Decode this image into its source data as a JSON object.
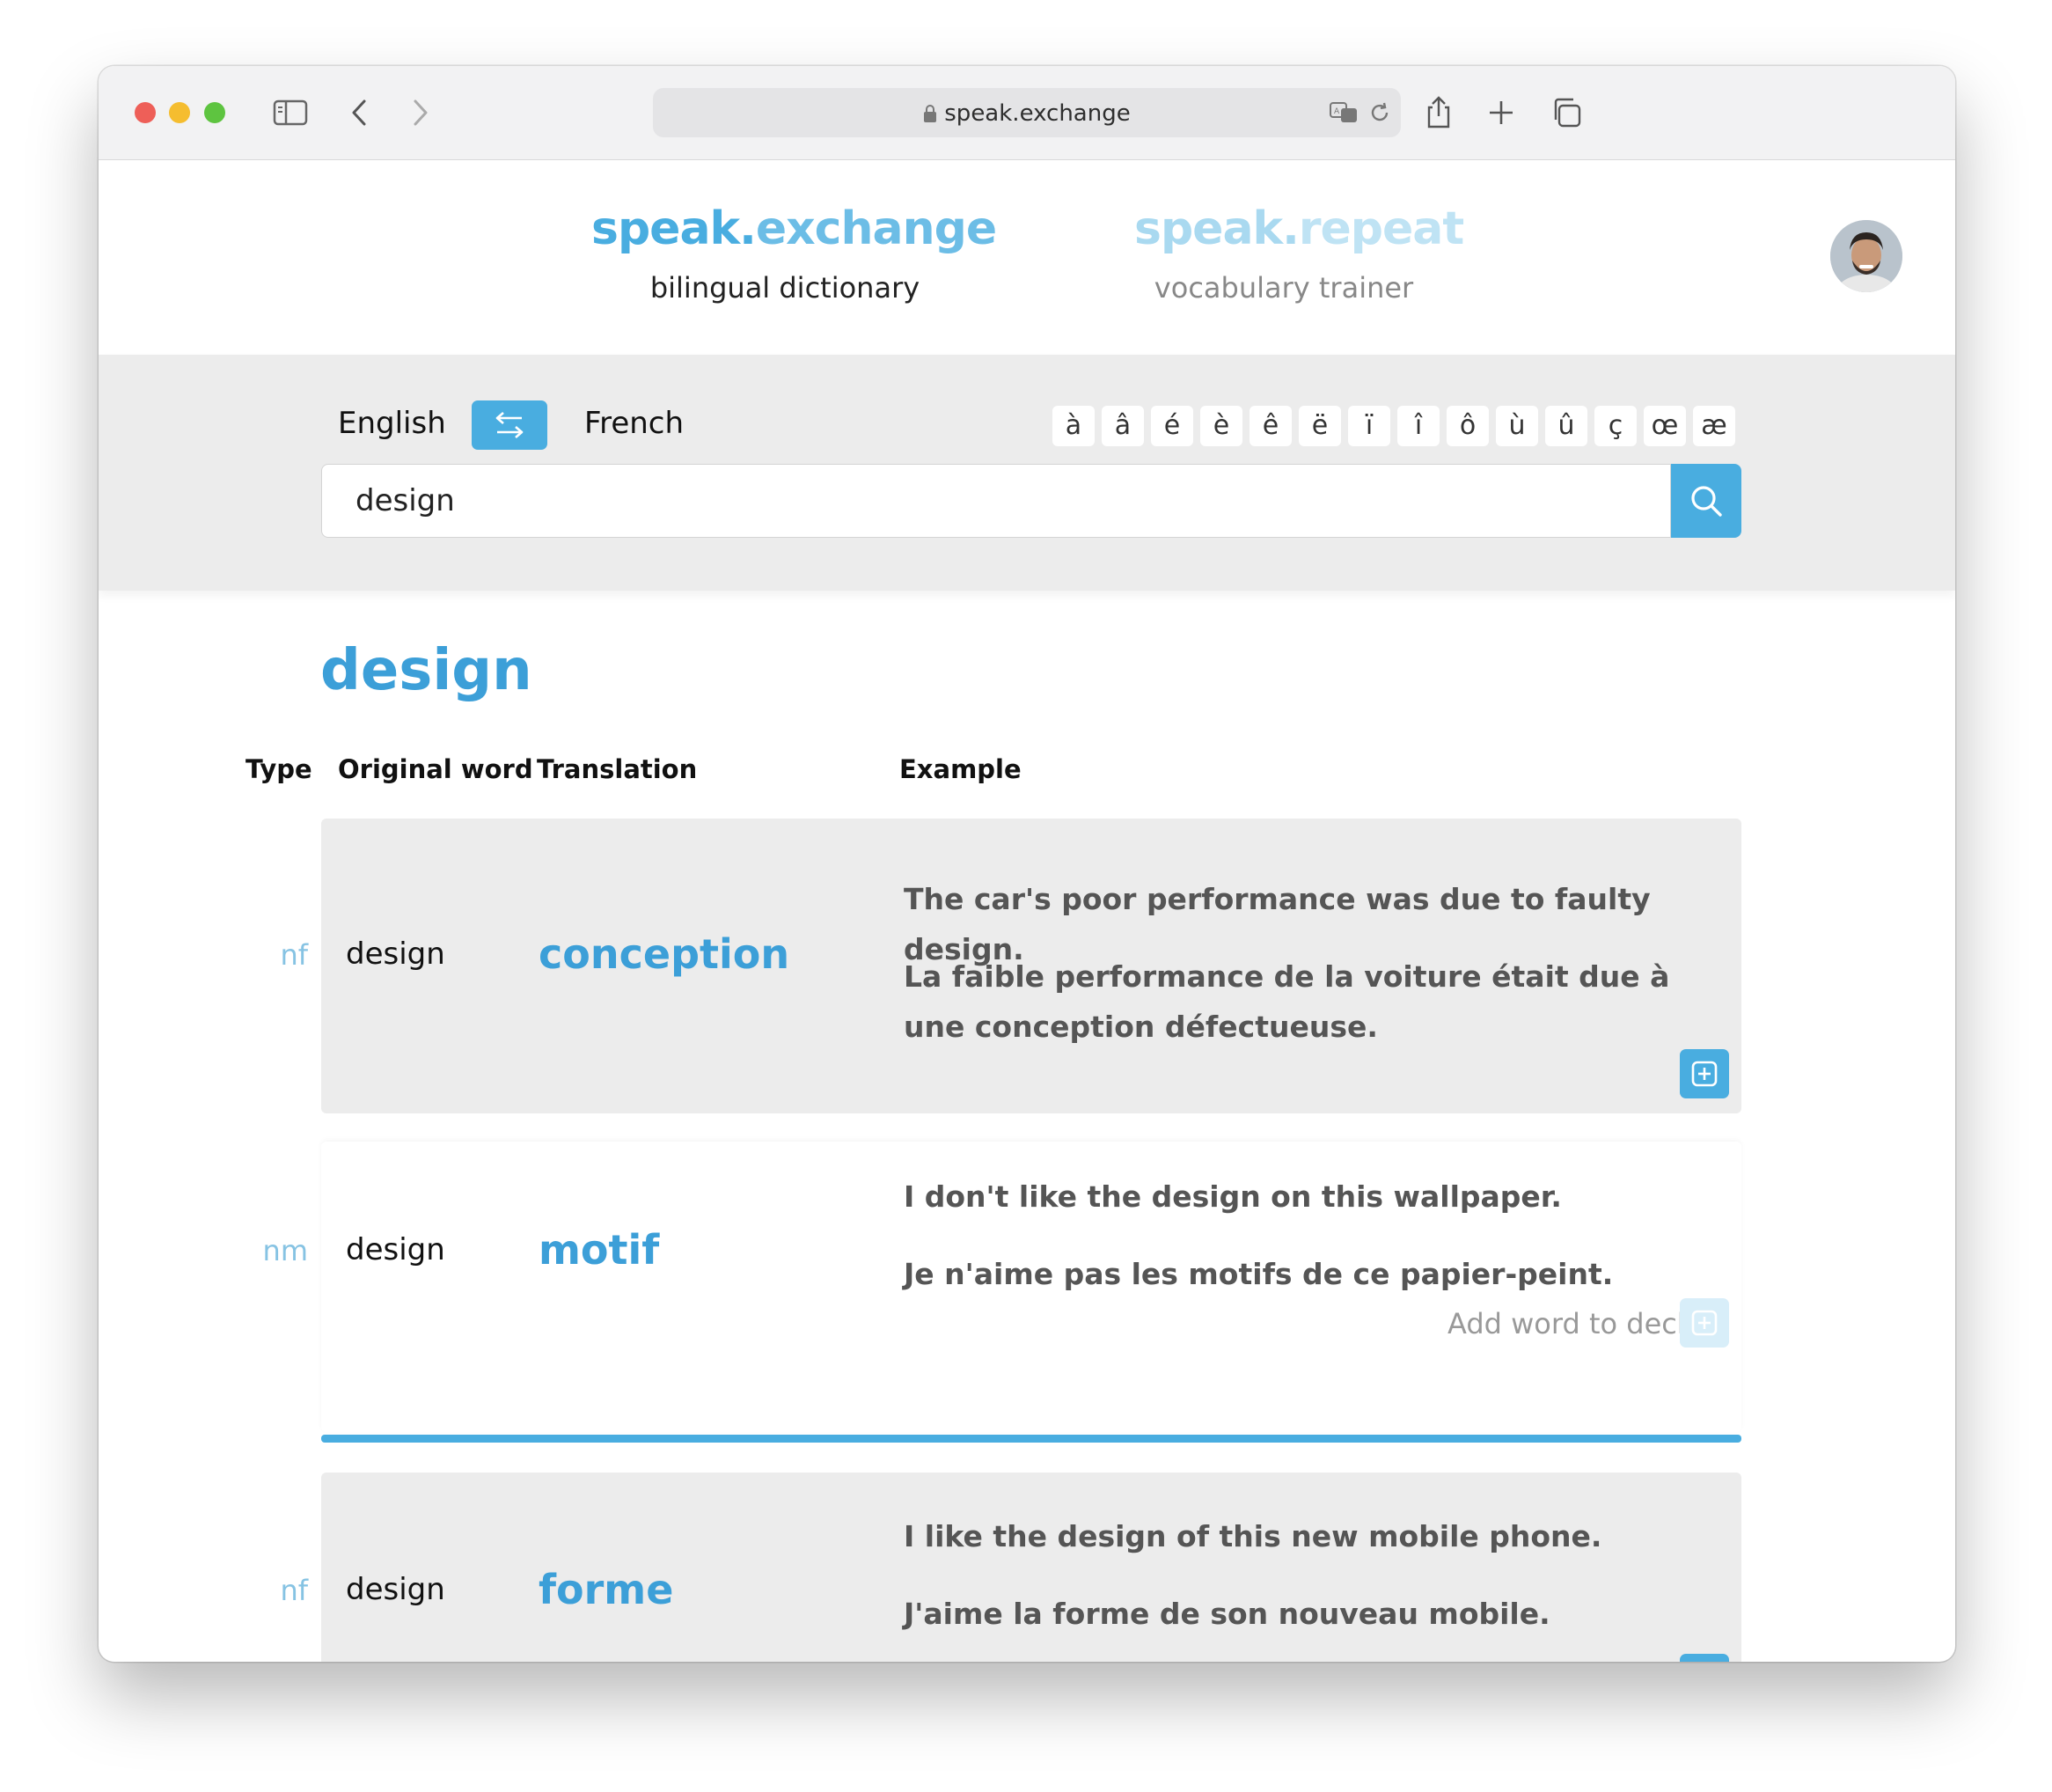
{
  "browser": {
    "url": "speak.exchange",
    "colors": {
      "close": "#ee5f58",
      "minimize": "#f5bd2f",
      "zoom": "#5ec440"
    }
  },
  "header": {
    "dictionary": {
      "logo_a": "speak.",
      "logo_b": "exchange",
      "subtitle": "bilingual dictionary"
    },
    "trainer": {
      "logo_a": "speak.",
      "logo_b": "repeat",
      "subtitle": "vocabulary trainer"
    }
  },
  "search": {
    "source_lang": "English",
    "target_lang": "French",
    "query": "design",
    "accents": [
      "à",
      "â",
      "é",
      "è",
      "ê",
      "ë",
      "ï",
      "î",
      "ô",
      "ù",
      "û",
      "ç",
      "œ",
      "æ"
    ]
  },
  "results": {
    "headword": "design",
    "columns": {
      "type": "Type",
      "original": "Original word",
      "translation": "Translation",
      "example": "Example"
    },
    "rows": [
      {
        "type": "nf",
        "original": "design",
        "translation": "conception",
        "example_en": "The car's poor performance was due to faulty design.",
        "example_fr": "La faible performance de la voiture était due à une conception défectueuse."
      },
      {
        "type": "nm",
        "original": "design",
        "translation": "motif",
        "example_en": "I don't like the design on this wallpaper.",
        "example_fr": "Je n'aime pas les motifs de ce papier-peint.",
        "add_label": "Add word to deck"
      },
      {
        "type": "nf",
        "original": "design",
        "translation": "forme",
        "example_en": "I like the design of this new mobile phone.",
        "example_fr": "J'aime la forme de son nouveau mobile."
      }
    ]
  },
  "theme": {
    "accent": "#49ade0",
    "accent_text": "#3c9fd8",
    "light_accent": "#a9d9f0"
  }
}
